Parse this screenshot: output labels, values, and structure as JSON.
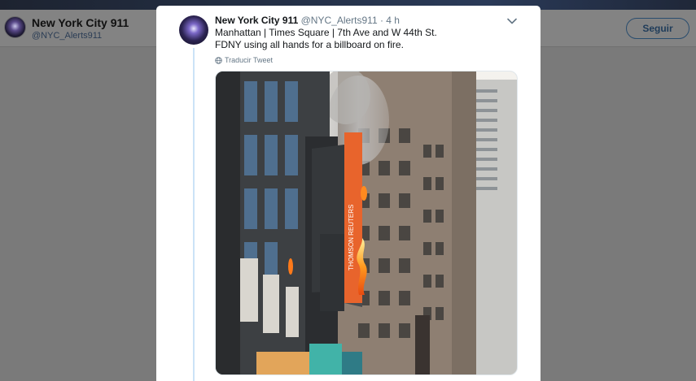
{
  "profile": {
    "name": "New York City 911",
    "handle": "@NYC_Alerts911",
    "follow_label": "Seguir"
  },
  "tweet": {
    "author_name": "New York City 911",
    "author_meta": "@NYC_Alerts911 · 4 h",
    "line1": "Manhattan | Times Square | 7th Ave and W 44th St.",
    "line2": "FDNY using all hands for a billboard on fire.",
    "translate_label": "Traducir Tweet",
    "photo_sign_text": "THOMSON REUTERS"
  },
  "icons": {
    "menu": "chevron-down-icon",
    "translate": "globe-icon"
  },
  "colors": {
    "accent": "#1da1f2",
    "fire": "#ff7a1a",
    "sign": "#e8642c"
  }
}
